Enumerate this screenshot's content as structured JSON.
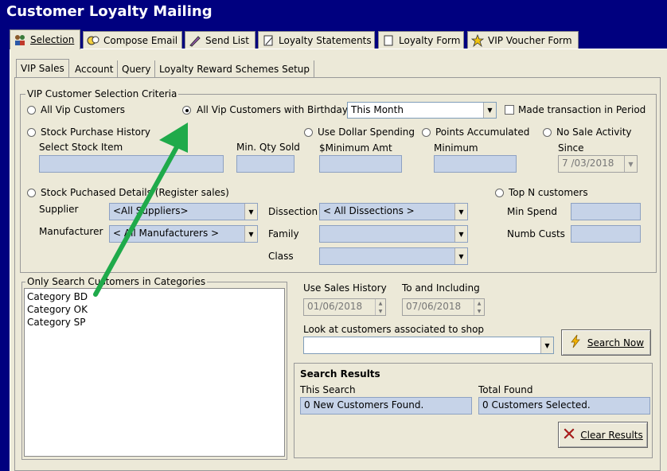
{
  "window": {
    "title": "Customer Loyalty Mailing"
  },
  "main_tabs": [
    {
      "label": "Selection",
      "icon": "people-icon"
    },
    {
      "label": "Compose Email",
      "icon": "faces-icon"
    },
    {
      "label": "Send List",
      "icon": "pen-icon"
    },
    {
      "label": "Loyalty Statements",
      "icon": "document-icon"
    },
    {
      "label": "Loyalty Form",
      "icon": "form-icon"
    },
    {
      "label": "VIP Voucher Form",
      "icon": "star-icon"
    }
  ],
  "sub_tabs": [
    "VIP Sales",
    "Account",
    "Query",
    "Loyalty Reward Schemes Setup"
  ],
  "criteria": {
    "group_label": "VIP Customer Selection Criteria",
    "all_vip": "All Vip Customers",
    "all_vip_birthday": "All Vip Customers with Birthday",
    "birthday_period": "This Month",
    "made_transaction": "Made transaction in Period",
    "stock_purchase_history": "Stock Purchase History",
    "select_stock_item": "Select Stock Item",
    "min_qty_sold": "Min. Qty Sold",
    "use_dollar_spending": "Use Dollar Spending",
    "minimum_amt": "$Minimum Amt",
    "points_accumulated": "Points Accumulated",
    "minimum": "Minimum",
    "no_sale_activity": "No Sale Activity",
    "since": "Since",
    "since_date": "7 /03/2018",
    "stock_purchased_details": "Stock Puchased Details (Register sales)",
    "supplier": "Supplier",
    "supplier_value": "<All Suppliers>",
    "manufacturer": "Manufacturer",
    "manufacturer_value": "< All Manufacturers >",
    "dissection": "Dissection",
    "dissection_value": "< All Dissections >",
    "family": "Family",
    "class": "Class",
    "top_n": "Top N customers",
    "min_spend": "Min Spend",
    "numb_custs": "Numb Custs"
  },
  "categories": {
    "group_label": "Only Search Customers in Categories",
    "items": [
      "Category BD",
      "Category OK",
      "Category SP"
    ]
  },
  "history": {
    "use_sales_history": "Use Sales History",
    "from_date": "01/06/2018",
    "to_and_including": "To and Including",
    "to_date": "07/06/2018",
    "look_at_shop": "Look at customers associated to shop"
  },
  "search_button": "Search Now",
  "results": {
    "title": "Search Results",
    "this_search_label": "This Search",
    "this_search_value": "0 New Customers Found.",
    "total_found_label": "Total Found",
    "total_found_value": "0 Customers Selected."
  },
  "clear_button": "Clear Results",
  "colors": {
    "titlebar": "#00007f",
    "panel": "#ece9d8",
    "field": "#c6d3e8",
    "arrow": "#1faa4a"
  }
}
